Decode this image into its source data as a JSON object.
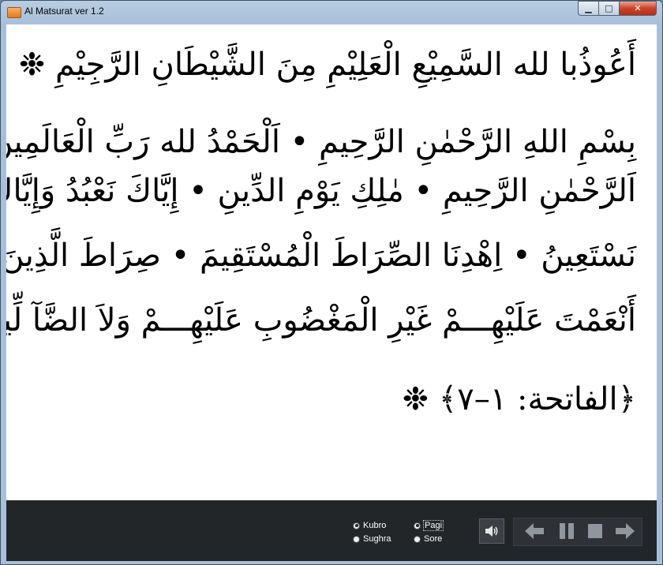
{
  "window": {
    "title": "Al Matsurat ver 1.2",
    "controls": {
      "minimize": "▁",
      "maximize": "□",
      "close": "✕"
    }
  },
  "content": {
    "lines": [
      "أَعُوذُبا لله السَّمِيْعِ الْعَلِيْمِ مِنَ الشَّيْطَانِ الرَّجِيْمِ ❉",
      "بِسْمِ اللهِ الرَّحْمٰنِ الرَّحِيمِ • اَلْحَمْدُ لله رَبِّ الْعَالَمِينَ •",
      "اَلرَّحْمٰنِ الرَّحِيمِ • مٰلِكِ يَوْمِ الدِّينِ • إِيَّاكَ نَعْبُدُ وَإِيَّاكَ",
      "نَسْتَعِينُ • اِهْدِنَا الصِّرَاطَ الْمُسْتَقِيمَ • صِرَاطَ الَّذِينَ",
      "أَنْعَمْتَ عَلَيْهِـــمْ غَيْرِ الْمَغْضُوبِ عَلَيْهِـــمْ وَلاَ الضَّآ لِّينَ",
      "﴿الفاتحة: ١–٧﴾ ❉"
    ]
  },
  "controls": {
    "mode_options": [
      {
        "label": "Kubro",
        "checked": true
      },
      {
        "label": "Sughra",
        "checked": false
      }
    ],
    "time_options": [
      {
        "label": "Pagi",
        "checked": true
      },
      {
        "label": "Sore",
        "checked": false
      }
    ],
    "icons": {
      "speaker": "speaker-icon",
      "previous": "arrow-left-icon",
      "pause": "pause-icon",
      "stop": "stop-icon",
      "next": "arrow-right-icon"
    }
  }
}
